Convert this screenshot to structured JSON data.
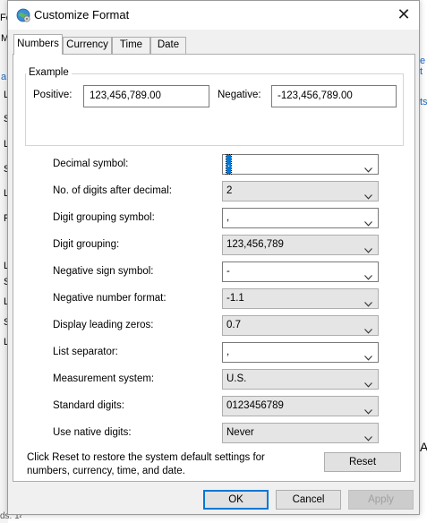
{
  "background": {
    "fragments": [
      "Fo",
      "M",
      "a",
      "L",
      "S",
      "L",
      "S",
      "L",
      "F",
      "L",
      "S",
      "L",
      "S",
      "L",
      "e t",
      "ts",
      "A"
    ],
    "status_text": "ds: 144"
  },
  "dialog": {
    "title": "Customize Format",
    "title_icon": "globe-settings-icon",
    "close_glyph": "✕"
  },
  "tabs": [
    {
      "label": "Numbers",
      "active": true
    },
    {
      "label": "Currency",
      "active": false
    },
    {
      "label": "Time",
      "active": false
    },
    {
      "label": "Date",
      "active": false
    }
  ],
  "example": {
    "group_label": "Example",
    "positive_label": "Positive:",
    "positive_value": "123,456,789.00",
    "negative_label": "Negative:",
    "negative_value": "-123,456,789.00"
  },
  "settings": [
    {
      "label": "Decimal symbol:",
      "value": ".",
      "editable": true,
      "selected": true
    },
    {
      "label": "No. of digits after decimal:",
      "value": "2",
      "editable": false
    },
    {
      "label": "Digit grouping symbol:",
      "value": ",",
      "editable": true
    },
    {
      "label": "Digit grouping:",
      "value": "123,456,789",
      "editable": false
    },
    {
      "label": "Negative sign symbol:",
      "value": "-",
      "editable": true
    },
    {
      "label": "Negative number format:",
      "value": "-1.1",
      "editable": false
    },
    {
      "label": "Display leading zeros:",
      "value": "0.7",
      "editable": false
    },
    {
      "label": "List separator:",
      "value": ",",
      "editable": true
    },
    {
      "label": "Measurement system:",
      "value": "U.S.",
      "editable": false
    },
    {
      "label": "Standard digits:",
      "value": "0123456789",
      "editable": false
    },
    {
      "label": "Use native digits:",
      "value": "Never",
      "editable": false
    }
  ],
  "reset_note": "Click Reset to restore the system default settings for numbers, currency, time, and date.",
  "buttons": {
    "reset": "Reset",
    "ok": "OK",
    "cancel": "Cancel",
    "apply": "Apply"
  },
  "colors": {
    "accent": "#0078d7",
    "dialog_bg": "#f0f0f0",
    "disabled_text": "#a0a0a0"
  }
}
